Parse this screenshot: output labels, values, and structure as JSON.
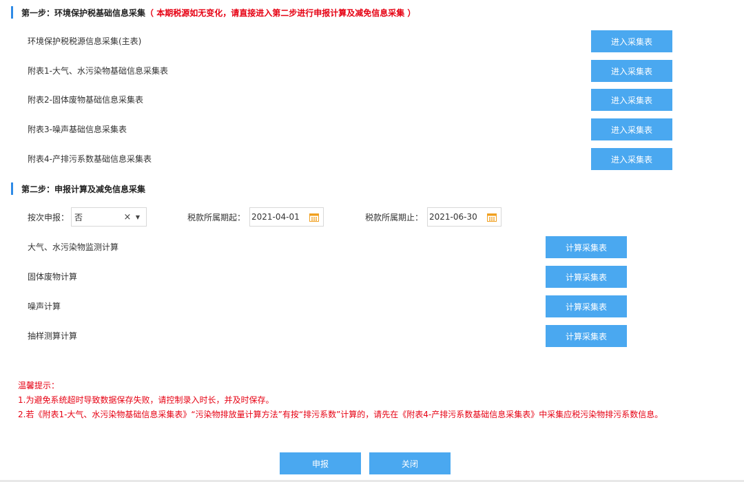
{
  "step1": {
    "title": "第一步：环境保护税基础信息采集",
    "note": "（ 本期税源如无变化，请直接进入第二步进行申报计算及减免信息采集 ）",
    "button_label": "进入采集表",
    "rows": [
      {
        "label": "环境保护税税源信息采集(主表)"
      },
      {
        "label": "附表1-大气、水污染物基础信息采集表"
      },
      {
        "label": "附表2-固体废物基础信息采集表"
      },
      {
        "label": "附表3-噪声基础信息采集表"
      },
      {
        "label": "附表4-产排污系数基础信息采集表"
      }
    ]
  },
  "step2": {
    "title": "第二步：申报计算及减免信息采集",
    "form": {
      "per_time_label": "按次申报：",
      "per_time_value": "否",
      "period_start_label": "税款所属期起：",
      "period_start_value": "2021-04-01",
      "period_end_label": "税款所属期止：",
      "period_end_value": "2021-06-30"
    },
    "button_label": "计算采集表",
    "rows": [
      {
        "label": "大气、水污染物监测计算"
      },
      {
        "label": "固体废物计算"
      },
      {
        "label": "噪声计算"
      },
      {
        "label": "抽样测算计算"
      }
    ]
  },
  "tips": {
    "title": "温馨提示：",
    "line1": "1.为避免系统超时导致数据保存失败，请控制录入时长，并及时保存。",
    "line2": "2.若《附表1-大气、水污染物基础信息采集表》“污染物排放量计算方法”有按“排污系数”计算的，请先在《附表4-产排污系数基础信息采集表》中采集应税污染物排污系数信息。"
  },
  "footer": {
    "submit_label": "申报",
    "close_label": "关闭"
  },
  "colors": {
    "accent": "#4aa8f0",
    "section_bar": "#2e8ae6",
    "warning": "#e60012",
    "calendar_icon": "#f0a020"
  },
  "icons": {
    "clear": "close-icon",
    "dropdown": "caret-down-icon",
    "date": "calendar-icon"
  }
}
